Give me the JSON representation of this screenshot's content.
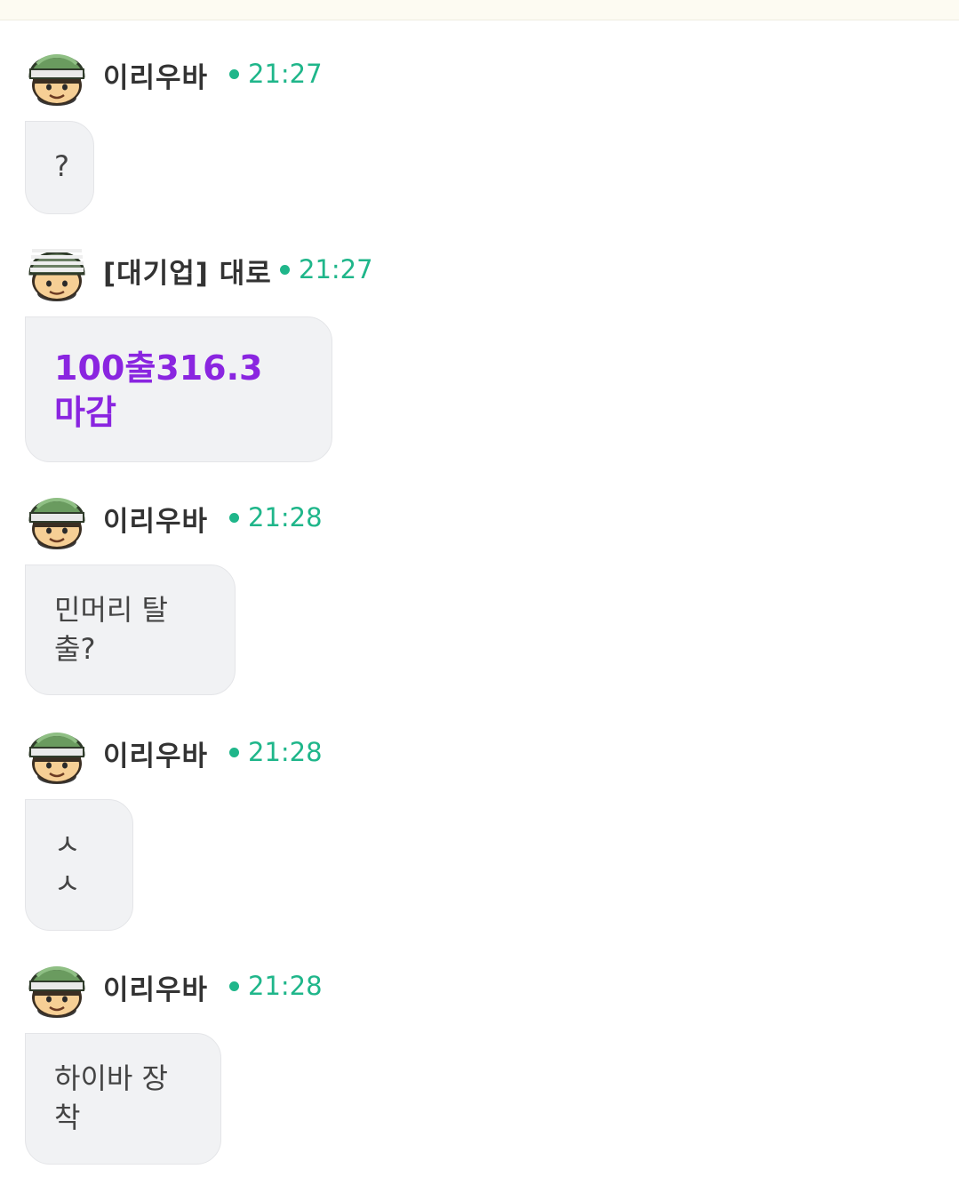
{
  "messages": [
    {
      "author": "이리우바",
      "time": "21:27",
      "avatar_icon": "soldier-helmet-icon",
      "text": "?"
    },
    {
      "author": "[대기업] 대로",
      "time": "21:27",
      "avatar_icon": "soldier-striped-helmet-icon",
      "text": "100출316.3 마감",
      "text_color": "#8a25e0"
    },
    {
      "author": "이리우바",
      "time": "21:28",
      "avatar_icon": "soldier-helmet-icon",
      "text": "민머리 탈출?"
    },
    {
      "author": "이리우바",
      "time": "21:28",
      "avatar_icon": "soldier-helmet-icon",
      "text": "ㅅㅅ"
    },
    {
      "author": "이리우바",
      "time": "21:28",
      "avatar_icon": "soldier-helmet-icon",
      "text": "하이바 장착"
    }
  ],
  "colors": {
    "time_accent": "#1fb68a",
    "bubble_bg": "#f1f2f4",
    "highlight_text": "#8a25e0"
  }
}
